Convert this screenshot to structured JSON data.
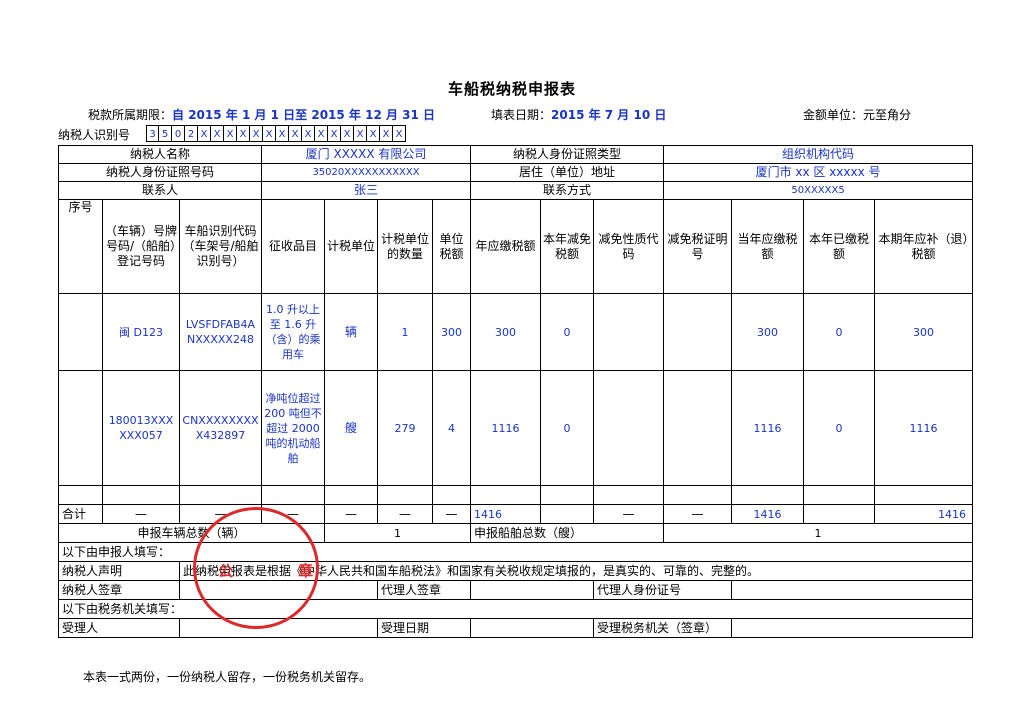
{
  "title": "车船税纳税申报表",
  "meta": {
    "period_label": "税款所属期限：",
    "period_value": "自 2015 年 1 月 1 日至 2015 年 12 月 31 日",
    "fill_label": "填表日期：",
    "fill_value": "2015 年 7 月 10 日",
    "currency": "金额单位：元至角分"
  },
  "tin": {
    "label": "纳税人识别号",
    "chars": [
      "3",
      "5",
      "0",
      "2",
      "X",
      "X",
      "X",
      "X",
      "X",
      "X",
      "X",
      "X",
      "X",
      "X",
      "X",
      "X",
      "X",
      "X",
      "X",
      "X"
    ]
  },
  "info": {
    "name_label": "纳税人名称",
    "name_value": "厦门 XXXXX 有限公司",
    "idtype_label": "纳税人身份证照类型",
    "idtype_value": "组织机构代码",
    "idno_label": "纳税人身份证照号码",
    "idno_value": "35020XXXXXXXXXXX",
    "address_label": "居住（单位）地址",
    "address_value": "厦门市 xx 区 xxxxx 号",
    "contact_label": "联系人",
    "contact_value": "张三",
    "phone_label": "联系方式",
    "phone_value": "50XXXXX5"
  },
  "headers": [
    "序号",
    "（车辆）号牌号码/（船舶）登记号码",
    "车船识别代码（车架号/船舶识别号）",
    "征收品目",
    "计税单位",
    "计税单位的数量",
    "单位税额",
    "年应缴税额",
    "本年减免税额",
    "减免性质代码",
    "减免税证明号",
    "当年应缴税额",
    "本年已缴税额",
    "本期年应补（退）税额"
  ],
  "rows": [
    {
      "seq": "",
      "plate": "闽 D123",
      "vin": "LVSFDFAB4ANXXXXX248",
      "item": "1.0 升以上至 1.6 升（含）的乘用车",
      "unit": "辆",
      "qty": "1",
      "unit_tax": "300",
      "annual": "300",
      "reduce": "0",
      "reduce_code": "",
      "reduce_cert": "",
      "due": "300",
      "paid": "0",
      "payable": "300"
    },
    {
      "seq": "",
      "plate": "180013XXXXXX057",
      "vin": "CNXXXXXXXXX432897",
      "item": "净吨位超过 200 吨但不超过 2000 吨的机动船舶",
      "unit": "艘",
      "qty": "279",
      "unit_tax": "4",
      "annual": "1116",
      "reduce": "0",
      "reduce_code": "",
      "reduce_cert": "",
      "due": "1116",
      "paid": "0",
      "payable": "1116"
    }
  ],
  "total": {
    "label": "合计",
    "dash": "—",
    "annual": "1416",
    "due": "1416",
    "payable": "1416"
  },
  "counts": {
    "vehicle_label": "申报车辆总数（辆）",
    "vehicle_value": "1",
    "ship_label": "申报船舶总数（艘）",
    "ship_value": "1"
  },
  "applicant_section": "以下由申报人填写：",
  "declaration_label": "纳税人声明",
  "declaration_text": "此纳税申报表是根据《中华人民共和国车船税法》和国家有关税收规定填报的，是真实的、可靠的、完整的。",
  "sign": {
    "taxpayer_sign": "纳税人签章",
    "agent_sign": "代理人签章",
    "agent_id": "代理人身份证号"
  },
  "tax_section": "以下由税务机关填写：",
  "receive": {
    "receiver": "受理人",
    "date": "受理日期",
    "office": "受理税务机关（签章）"
  },
  "footer": "本表一式两份，一份纳税人留存，一份税务机关留存。",
  "seal_text": "公 章",
  "colors": {
    "value_blue": "#1a33c8",
    "seal_red": "#e0272a"
  }
}
